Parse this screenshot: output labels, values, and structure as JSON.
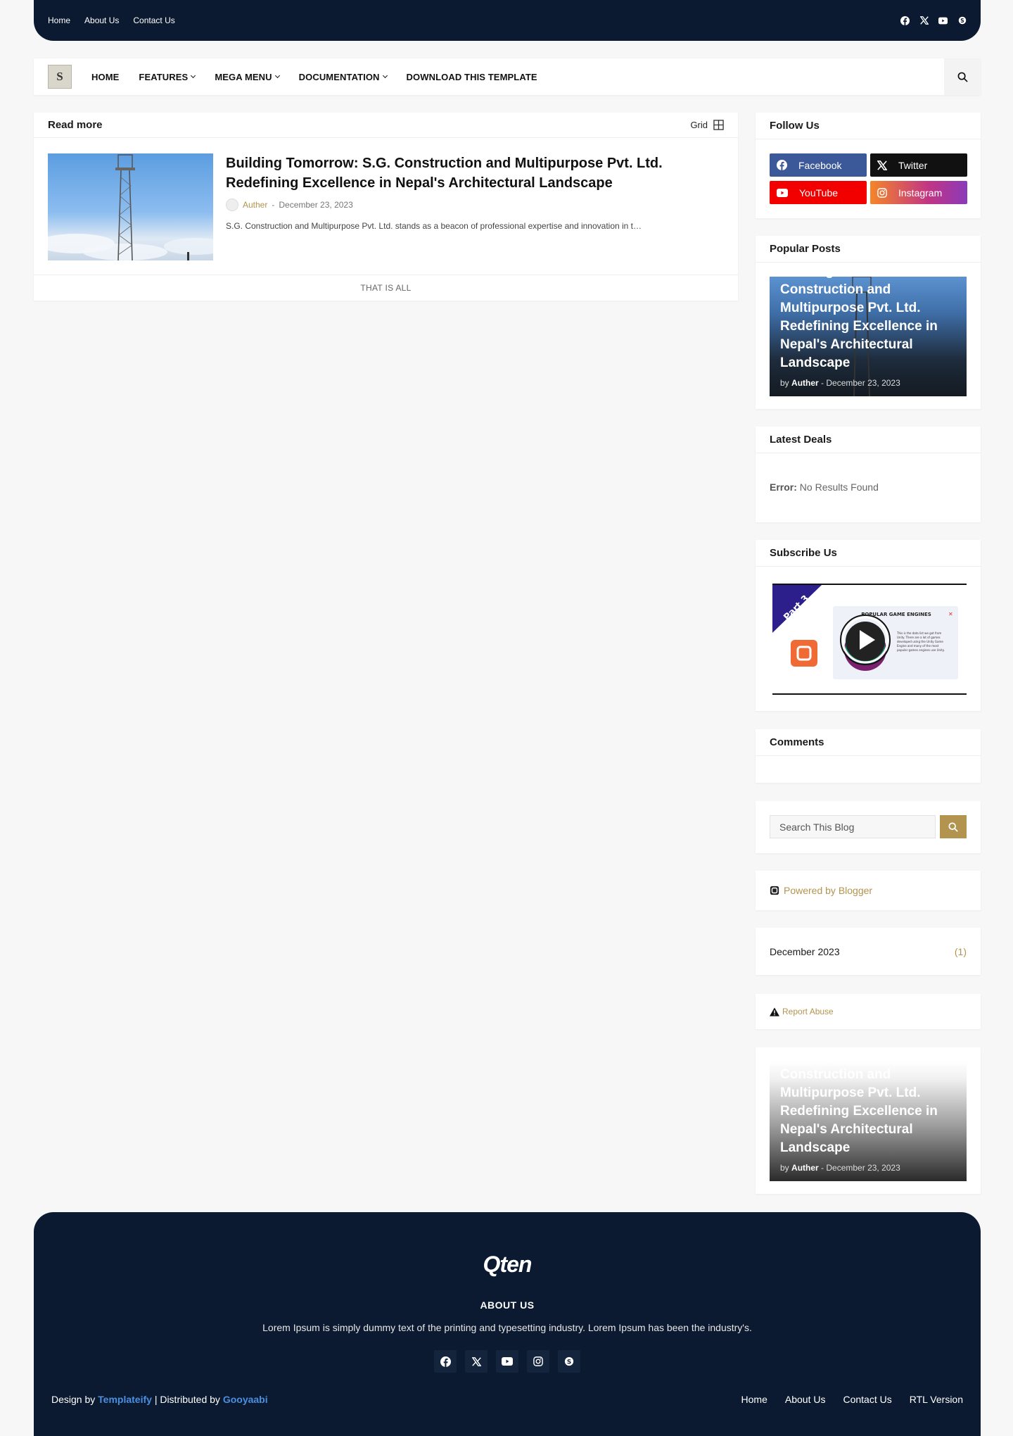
{
  "topbar": {
    "links": [
      "Home",
      "About Us",
      "Contact Us"
    ],
    "social_icons": [
      "facebook-icon",
      "x-icon",
      "youtube-icon",
      "skype-icon"
    ]
  },
  "nav": {
    "logo_text": "S",
    "menu": [
      {
        "label": "HOME",
        "has_dropdown": false
      },
      {
        "label": "FEATURES",
        "has_dropdown": true
      },
      {
        "label": "MEGA MENU",
        "has_dropdown": true
      },
      {
        "label": "DOCUMENTATION",
        "has_dropdown": true
      },
      {
        "label": "DOWNLOAD THIS TEMPLATE",
        "has_dropdown": false
      }
    ]
  },
  "main": {
    "section_title": "Read more",
    "view_label": "Grid",
    "posts": [
      {
        "title": "Building Tomorrow: S.G. Construction and Multipurpose Pvt. Ltd. Redefining Excellence in Nepal's Architectural Landscape",
        "author": "Auther",
        "separator": "-",
        "date": "December 23, 2023",
        "excerpt": "S.G. Construction and Multipurpose Pvt. Ltd. stands as a beacon of professional expertise and innovation in t…"
      }
    ],
    "end_text": "THAT IS ALL"
  },
  "sidebar": {
    "follow": {
      "title": "Follow Us",
      "buttons": [
        {
          "label": "Facebook",
          "color": "#3b5998",
          "icon": "facebook-icon"
        },
        {
          "label": "Twitter",
          "color": "#111111",
          "icon": "x-icon"
        },
        {
          "label": "YouTube",
          "color": "#f20000",
          "icon": "youtube-icon"
        },
        {
          "label": "Instagram",
          "color": "#c13584",
          "icon": "instagram-icon"
        }
      ]
    },
    "popular": {
      "title": "Popular Posts",
      "post_title": "Building Tomorrow: S.G. Construction and Multipurpose Pvt. Ltd. Redefining Excellence in Nepal's Architectural Landscape",
      "by": "by",
      "author": "Auther",
      "date": "- December 23, 2023"
    },
    "deals": {
      "title": "Latest Deals",
      "error_label": "Error:",
      "error_text": "No Results Found"
    },
    "subscribe": {
      "title": "Subscribe Us",
      "ribbon": "Part 3",
      "card_title": "POPULAR GAME ENGINES",
      "card_text": "This is the data list we got from Unity. There are a lot of games developed using the Unity Game Engine and many of the most popular games engines use Unity."
    },
    "comments": {
      "title": "Comments"
    },
    "search": {
      "placeholder": "Search This Blog"
    },
    "powered": {
      "label": "Powered by Blogger"
    },
    "archive": {
      "month": "December 2023",
      "count": "(1)"
    },
    "report": {
      "label": "Report Abuse"
    },
    "featured": {
      "post_title": "Building Tomorrow: S.G. Construction and Multipurpose Pvt. Ltd. Redefining Excellence in Nepal's Architectural Landscape",
      "by": "by",
      "author": "Auther",
      "date": "- December 23, 2023"
    }
  },
  "footer": {
    "logo": "Qten",
    "about_title": "ABOUT US",
    "about_text": "Lorem Ipsum is simply dummy text of the printing and typesetting industry. Lorem Ipsum has been the industry's.",
    "design_prefix": "Design by",
    "design_name": "Templateify",
    "distributed_prefix": "| Distributed by",
    "distributed_name": "Gooyaabi",
    "links": [
      "Home",
      "About Us",
      "Contact Us",
      "RTL Version"
    ]
  },
  "colors": {
    "dark_navy": "#0b1a30",
    "accent_gold": "#b3944e",
    "footer_link_blue": "#4a8fe0"
  }
}
